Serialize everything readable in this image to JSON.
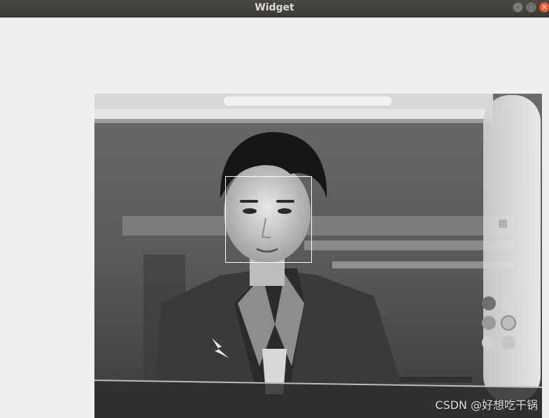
{
  "window": {
    "title": "Widget",
    "controls": {
      "minimize": "–",
      "maximize": "□",
      "close": "×"
    }
  },
  "camera": {
    "watermark": "CSDN @好想吃干锅",
    "face_detected": true
  }
}
